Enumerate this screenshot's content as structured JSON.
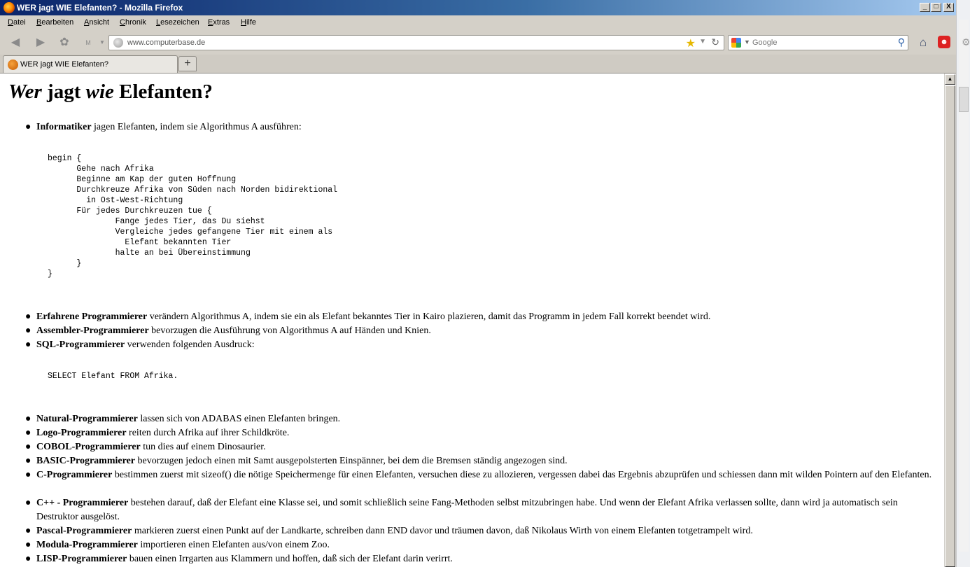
{
  "window": {
    "title": "WER jagt WIE Elefanten? - Mozilla Firefox",
    "controls": {
      "minimize": "_",
      "maximize": "□",
      "close": "X"
    }
  },
  "menubar": {
    "items": [
      {
        "accel": "D",
        "rest": "atei"
      },
      {
        "accel": "B",
        "rest": "earbeiten"
      },
      {
        "accel": "A",
        "rest": "nsicht"
      },
      {
        "accel": "C",
        "rest": "hronik"
      },
      {
        "accel": "L",
        "rest": "esezeichen"
      },
      {
        "accel": "E",
        "rest": "xtras"
      },
      {
        "accel": "H",
        "rest": "ilfe"
      }
    ]
  },
  "navbar": {
    "url": "www.computerbase.de",
    "search_placeholder": "Google",
    "back_label": "M"
  },
  "tab": {
    "label": "WER jagt WIE Elefanten?",
    "new_tab": "+"
  },
  "page": {
    "title": {
      "w1": "Wer",
      "w2": " jagt ",
      "w3": "wie",
      "w4": " Elefanten?"
    },
    "items": [
      {
        "name": "Informatiker",
        "text": " jagen Elefanten, indem sie Algorithmus A ausführen:"
      },
      {
        "name": "Erfahrene Programmierer",
        "text": " verändern Algorithmus A, indem sie ein als Elefant bekanntes Tier in Kairo plazieren, damit das Programm in jedem Fall korrekt beendet wird."
      },
      {
        "name": "Assembler-Programmierer",
        "text": " bevorzugen die Ausführung von Algorithmus A auf Händen und Knien."
      },
      {
        "name": "SQL-Programmierer",
        "text": " verwenden folgenden Ausdruck:"
      },
      {
        "name": "Natural-Programmierer",
        "text": " lassen sich von ADABAS einen Elefanten bringen."
      },
      {
        "name": "Logo-Programmierer",
        "text": " reiten durch Afrika auf ihrer Schildkröte."
      },
      {
        "name": "COBOL-Programmierer",
        "text": " tun dies auf einem Dinosaurier."
      },
      {
        "name": "BASIC-Programmierer",
        "text": " bevorzugen jedoch einen mit Samt ausgepolsterten Einspänner, bei dem die Bremsen ständig angezogen sind."
      },
      {
        "name": "C-Programmierer",
        "text": " bestimmen zuerst mit sizeof() die nötige Speichermenge für einen Elefanten, versuchen diese zu allozieren, vergessen dabei das Ergebnis abzuprüfen und schiessen dann mit wilden Pointern auf den Elefanten."
      },
      {
        "name": "C++ - Programmierer",
        "text": " bestehen darauf, daß der Elefant eine Klasse sei, und somit schließlich seine Fang-Methoden selbst mitzubringen habe. Und wenn der Elefant Afrika verlassen sollte, dann wird ja automatisch sein Destruktor ausgelöst."
      },
      {
        "name": "Pascal-Programmierer",
        "text": " markieren zuerst einen Punkt auf der Landkarte, schreiben dann END davor und träumen davon, daß Nikolaus Wirth von einem Elefanten totgetrampelt wird."
      },
      {
        "name": "Modula-Programmierer",
        "text": " importieren einen Elefanten aus/von einem Zoo."
      },
      {
        "name": "LISP-Programmierer",
        "text": " bauen einen Irrgarten aus Klammern und hoffen, daß sich der Elefant darin verirrt."
      }
    ],
    "code_algorithm": "begin {\n      Gehe nach Afrika\n      Beginne am Kap der guten Hoffnung\n      Durchkreuze Afrika von Süden nach Norden bidirektional\n        in Ost-West-Richtung\n      Für jedes Durchkreuzen tue {\n              Fange jedes Tier, das Du siehst\n              Vergleiche jedes gefangene Tier mit einem als\n                Elefant bekannten Tier\n              halte an bei Übereinstimmung\n      }\n}",
    "code_sql": "SELECT Elefant FROM Afrika."
  }
}
